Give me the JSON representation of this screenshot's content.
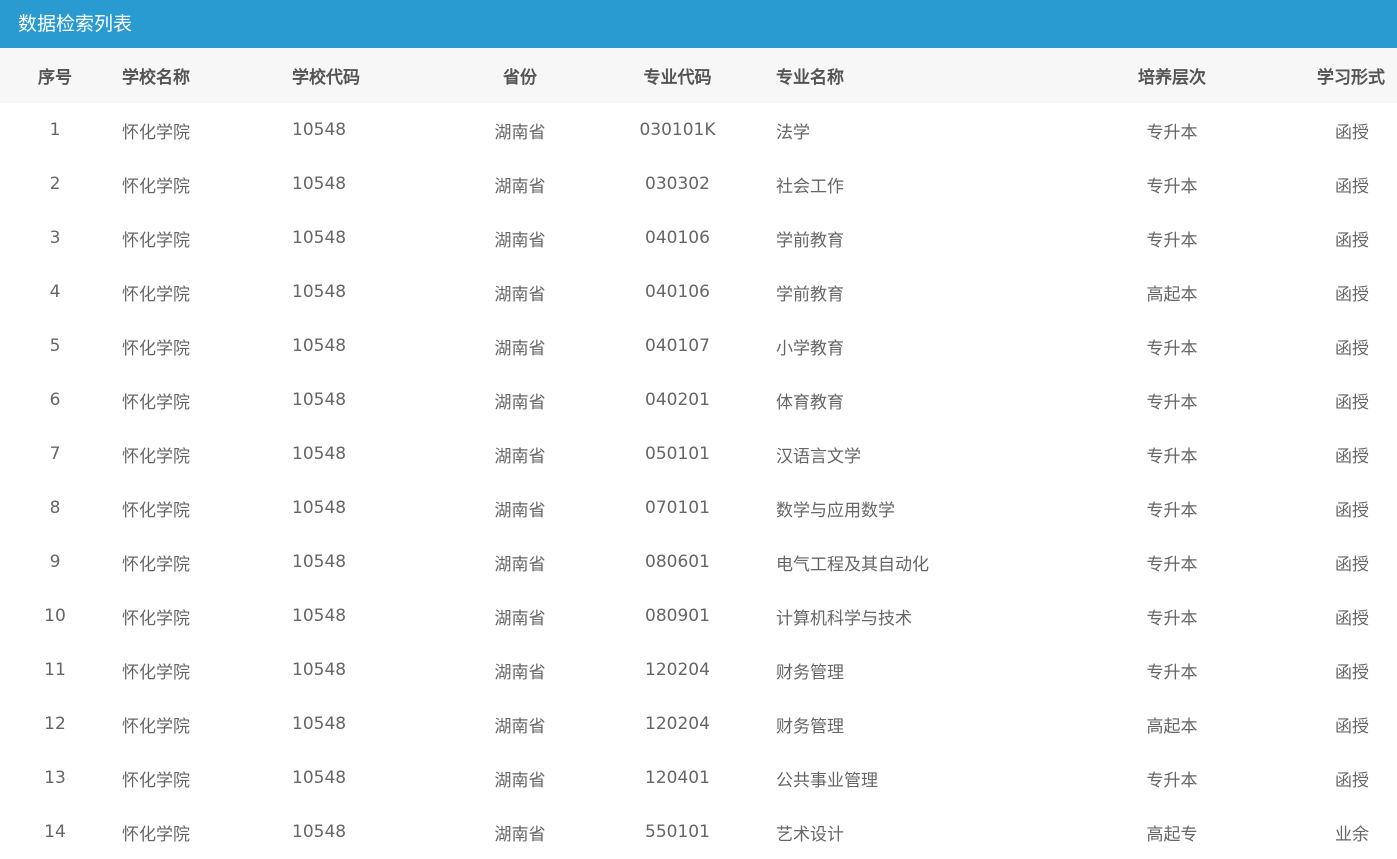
{
  "title": "数据检索列表",
  "columns": {
    "index": "序号",
    "school_name": "学校名称",
    "school_code": "学校代码",
    "province": "省份",
    "major_code": "专业代码",
    "major_name": "专业名称",
    "level": "培养层次",
    "study_form": "学习形式"
  },
  "rows": [
    {
      "index": "1",
      "school_name": "怀化学院",
      "school_code": "10548",
      "province": "湖南省",
      "major_code": "030101K",
      "major_name": "法学",
      "level": "专升本",
      "study_form": "函授"
    },
    {
      "index": "2",
      "school_name": "怀化学院",
      "school_code": "10548",
      "province": "湖南省",
      "major_code": "030302",
      "major_name": "社会工作",
      "level": "专升本",
      "study_form": "函授"
    },
    {
      "index": "3",
      "school_name": "怀化学院",
      "school_code": "10548",
      "province": "湖南省",
      "major_code": "040106",
      "major_name": "学前教育",
      "level": "专升本",
      "study_form": "函授"
    },
    {
      "index": "4",
      "school_name": "怀化学院",
      "school_code": "10548",
      "province": "湖南省",
      "major_code": "040106",
      "major_name": "学前教育",
      "level": "高起本",
      "study_form": "函授"
    },
    {
      "index": "5",
      "school_name": "怀化学院",
      "school_code": "10548",
      "province": "湖南省",
      "major_code": "040107",
      "major_name": "小学教育",
      "level": "专升本",
      "study_form": "函授"
    },
    {
      "index": "6",
      "school_name": "怀化学院",
      "school_code": "10548",
      "province": "湖南省",
      "major_code": "040201",
      "major_name": "体育教育",
      "level": "专升本",
      "study_form": "函授"
    },
    {
      "index": "7",
      "school_name": "怀化学院",
      "school_code": "10548",
      "province": "湖南省",
      "major_code": "050101",
      "major_name": "汉语言文学",
      "level": "专升本",
      "study_form": "函授"
    },
    {
      "index": "8",
      "school_name": "怀化学院",
      "school_code": "10548",
      "province": "湖南省",
      "major_code": "070101",
      "major_name": "数学与应用数学",
      "level": "专升本",
      "study_form": "函授"
    },
    {
      "index": "9",
      "school_name": "怀化学院",
      "school_code": "10548",
      "province": "湖南省",
      "major_code": "080601",
      "major_name": "电气工程及其自动化",
      "level": "专升本",
      "study_form": "函授"
    },
    {
      "index": "10",
      "school_name": "怀化学院",
      "school_code": "10548",
      "province": "湖南省",
      "major_code": "080901",
      "major_name": "计算机科学与技术",
      "level": "专升本",
      "study_form": "函授"
    },
    {
      "index": "11",
      "school_name": "怀化学院",
      "school_code": "10548",
      "province": "湖南省",
      "major_code": "120204",
      "major_name": "财务管理",
      "level": "专升本",
      "study_form": "函授"
    },
    {
      "index": "12",
      "school_name": "怀化学院",
      "school_code": "10548",
      "province": "湖南省",
      "major_code": "120204",
      "major_name": "财务管理",
      "level": "高起本",
      "study_form": "函授"
    },
    {
      "index": "13",
      "school_name": "怀化学院",
      "school_code": "10548",
      "province": "湖南省",
      "major_code": "120401",
      "major_name": "公共事业管理",
      "level": "专升本",
      "study_form": "函授"
    },
    {
      "index": "14",
      "school_name": "怀化学院",
      "school_code": "10548",
      "province": "湖南省",
      "major_code": "550101",
      "major_name": "艺术设计",
      "level": "高起专",
      "study_form": "业余"
    }
  ]
}
